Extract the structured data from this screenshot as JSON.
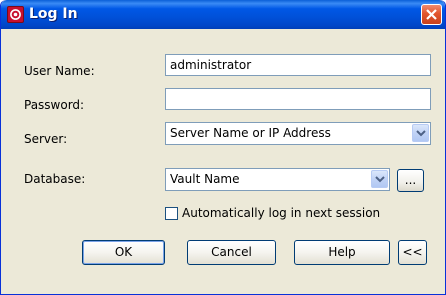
{
  "window": {
    "title": "Log In",
    "close_label": "Close"
  },
  "form": {
    "user_name_label": "User Name:",
    "user_name_value": "administrator",
    "password_label": "Password:",
    "password_value": "",
    "server_label": "Server:",
    "server_value": "Server Name or IP Address",
    "database_label": "Database:",
    "database_value": "Vault Name",
    "browse_label": "...",
    "auto_login_label": "Automatically log in next session",
    "auto_login_checked": false
  },
  "buttons": {
    "ok": "OK",
    "cancel": "Cancel",
    "help": "Help",
    "collapse": "<<"
  },
  "colors": {
    "titlebar": "#0050d8",
    "dialog_bg": "#ece9d8",
    "close_red": "#e2562e",
    "app_icon_red": "#c8102e"
  },
  "icons": {
    "app": "app-logo-icon",
    "close": "close-icon",
    "dropdown": "chevron-down-icon"
  }
}
